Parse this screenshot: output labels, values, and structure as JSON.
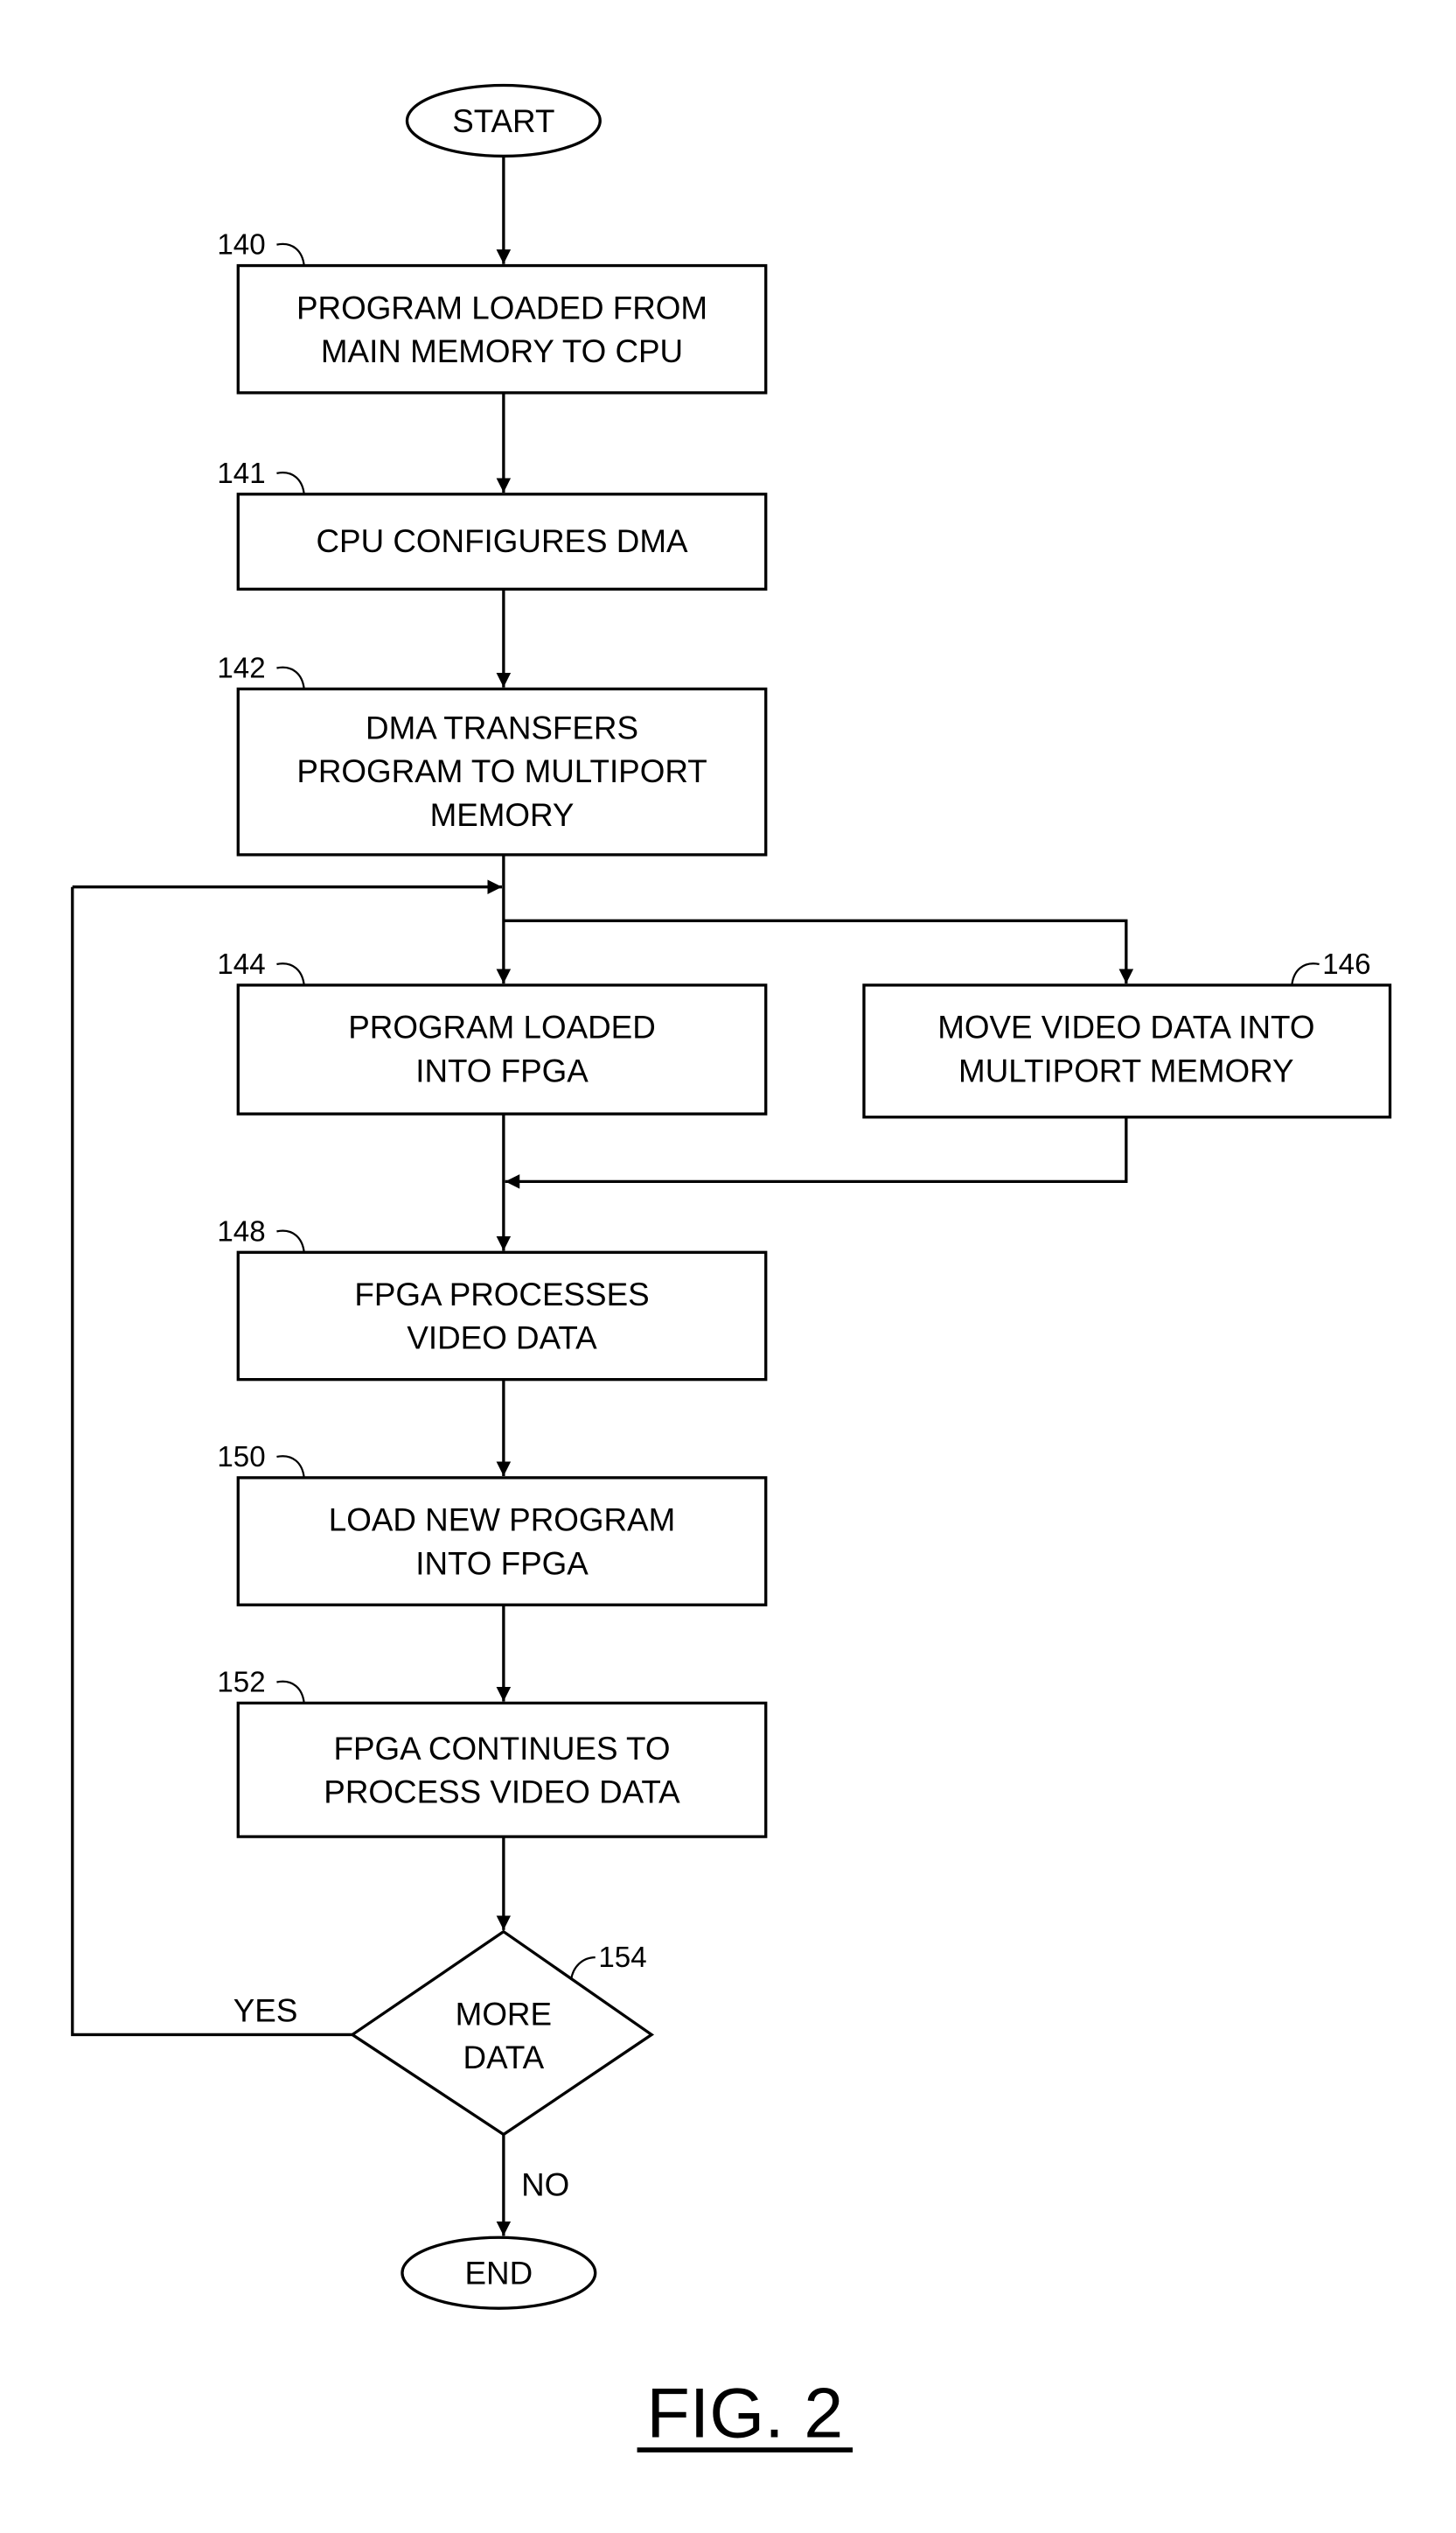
{
  "figure": {
    "label": "FIG. 2",
    "start": "START",
    "end": "END",
    "steps": [
      {
        "ref": "140",
        "lines": [
          "PROGRAM LOADED FROM",
          "MAIN MEMORY TO CPU"
        ]
      },
      {
        "ref": "141",
        "lines": [
          "CPU CONFIGURES DMA"
        ]
      },
      {
        "ref": "142",
        "lines": [
          "DMA TRANSFERS",
          "PROGRAM TO MULTIPORT",
          "MEMORY"
        ]
      },
      {
        "ref": "144",
        "lines": [
          "PROGRAM LOADED",
          "INTO FPGA"
        ]
      },
      {
        "ref": "146",
        "lines": [
          "MOVE VIDEO DATA INTO",
          "MULTIPORT MEMORY"
        ]
      },
      {
        "ref": "148",
        "lines": [
          "FPGA PROCESSES",
          "VIDEO DATA"
        ]
      },
      {
        "ref": "150",
        "lines": [
          "LOAD NEW PROGRAM",
          "INTO FPGA"
        ]
      },
      {
        "ref": "152",
        "lines": [
          "FPGA CONTINUES TO",
          "PROCESS VIDEO DATA"
        ]
      }
    ],
    "decision": {
      "ref": "154",
      "lines": [
        "MORE",
        "DATA"
      ],
      "yes_label": "YES",
      "no_label": "NO"
    }
  }
}
